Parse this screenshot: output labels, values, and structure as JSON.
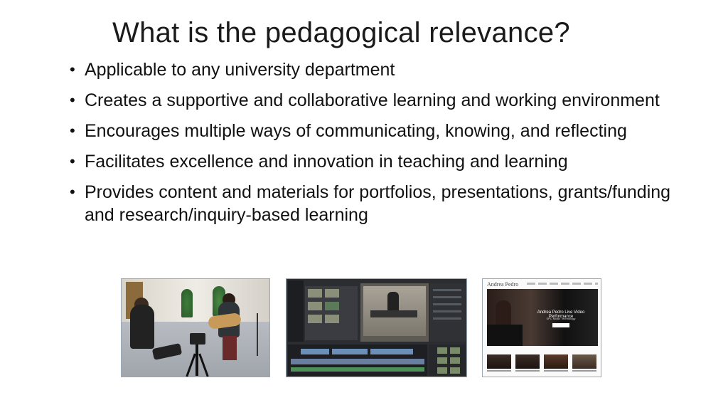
{
  "slide": {
    "title": "What is the pedagogical relevance?",
    "bullets": [
      "Applicable to any university department",
      "Creates a supportive and collaborative learning and working environment",
      "Encourages multiple ways of communicating, knowing, and reflecting",
      "Facilitates excellence and innovation in teaching and learning",
      "Provides content and materials for portfolios, presentations, grants/funding and research/inquiry-based learning"
    ],
    "bullet_symbol": "•"
  },
  "images": {
    "website": {
      "name": "Andrea Pedro",
      "hero_title": "Andrea Pedro Live Video Performance",
      "hero_sub": "SPC Music Technology"
    }
  }
}
